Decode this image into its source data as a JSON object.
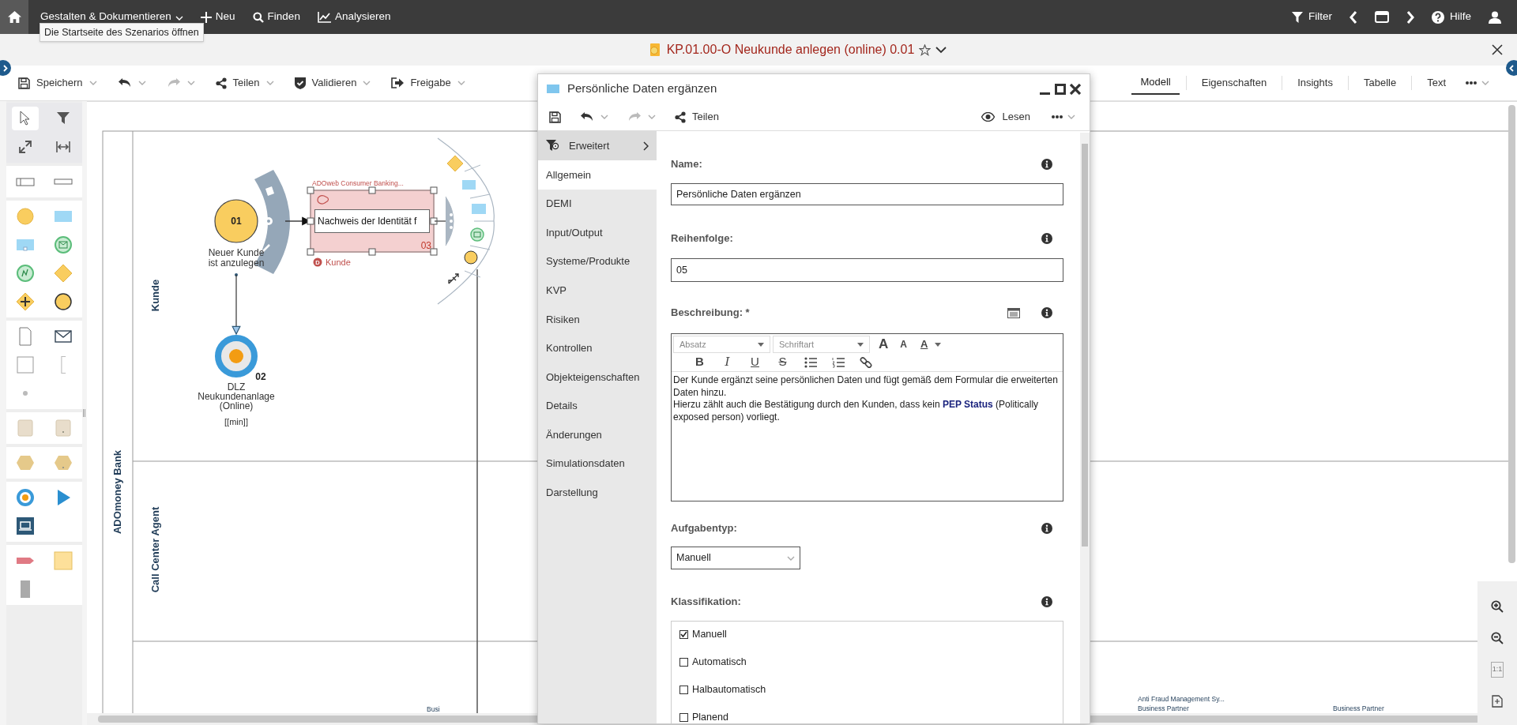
{
  "top_bar": {
    "home_tooltip": "Die Startseite des Szenarios öffnen",
    "menus": [
      {
        "kind": "dropdown",
        "label": "Gestalten & Dokumentieren"
      },
      {
        "kind": "new",
        "label": "Neu"
      },
      {
        "kind": "search",
        "label": "Finden"
      },
      {
        "kind": "chart",
        "label": "Analysieren"
      }
    ],
    "right": [
      {
        "kind": "filter",
        "label": "Filter"
      },
      {
        "kind": "prev"
      },
      {
        "kind": "window"
      },
      {
        "kind": "next"
      },
      {
        "kind": "help",
        "label": "Hilfe"
      },
      {
        "kind": "user"
      }
    ]
  },
  "model_title": {
    "title": "KP.01.00-O Neukunde anlegen (online) 0.01",
    "favorite": false
  },
  "toolbar": {
    "buttons": [
      {
        "kind": "save",
        "label": "Speichern"
      },
      {
        "kind": "undo",
        "disabled": false
      },
      {
        "kind": "redo",
        "disabled": true
      },
      {
        "kind": "share",
        "label": "Teilen"
      },
      {
        "kind": "validate",
        "label": "Validieren"
      },
      {
        "kind": "release",
        "label": "Freigabe"
      }
    ],
    "view_tabs": [
      {
        "label": "Modell",
        "selected": true
      },
      {
        "label": "Eigenschaften",
        "selected": false
      },
      {
        "label": "Insights",
        "selected": false
      },
      {
        "label": "Tabelle",
        "selected": false
      },
      {
        "label": "Text",
        "selected": false
      }
    ]
  },
  "diagram": {
    "pool": "ADOmoney Bank",
    "lanes": [
      {
        "label": "Kunde"
      },
      {
        "label": "Call Center Agent"
      }
    ],
    "start_event": {
      "number": "01",
      "label_lines": [
        "Neuer Kunde",
        "ist anzulegen"
      ]
    },
    "task": {
      "system": "ADOweb Consumer Banking...",
      "editing_text": "Nachweis der Identität f",
      "number": "03",
      "role_badge": "D",
      "role": "Kunde",
      "selected": true
    },
    "end_event": {
      "number": "02",
      "label_lines": [
        "DLZ",
        "Neukundenanlage",
        "(Online)"
      ],
      "unit": "[[min]]"
    },
    "bottom_labels": [
      "Busi",
      "Anti Fraud Management Sy...",
      "Business Partner",
      "Business Partner"
    ]
  },
  "zoom_controls": [
    {
      "kind": "zoom_in"
    },
    {
      "kind": "zoom_out"
    },
    {
      "kind": "actual_size",
      "label": "1:1",
      "disabled": true
    },
    {
      "kind": "fit"
    }
  ],
  "dialog": {
    "title": "Persönliche Daten ergänzen",
    "toolbar": {
      "buttons": [
        {
          "kind": "save"
        },
        {
          "kind": "undo",
          "disabled": false
        },
        {
          "kind": "redo",
          "disabled": true
        },
        {
          "kind": "share",
          "label": "Teilen"
        }
      ],
      "mode": "Lesen"
    },
    "filter": "Erweitert",
    "nav": [
      {
        "label": "Allgemein",
        "selected": true
      },
      {
        "label": "DEMI",
        "selected": false
      },
      {
        "label": "Input/Output",
        "selected": false
      },
      {
        "label": "Systeme/Produkte",
        "selected": false
      },
      {
        "label": "KVP",
        "selected": false
      },
      {
        "label": "Risiken",
        "selected": false
      },
      {
        "label": "Kontrollen",
        "selected": false
      },
      {
        "label": "Objekteigenschaften",
        "selected": false
      },
      {
        "label": "Details",
        "selected": false
      },
      {
        "label": "Änderungen",
        "selected": false
      },
      {
        "label": "Simulationsdaten",
        "selected": false
      },
      {
        "label": "Darstellung",
        "selected": false
      }
    ],
    "name": {
      "label": "Name:",
      "value": "Persönliche Daten ergänzen"
    },
    "order": {
      "label": "Reihenfolge:",
      "value": "05"
    },
    "description": {
      "label": "Beschreibung: *",
      "paragraph_style": "Absatz",
      "font": "Schriftart",
      "size_buttons": [
        {
          "kind": "grow",
          "label": "A"
        },
        {
          "kind": "shrink",
          "label": "A"
        },
        {
          "kind": "color",
          "label": "A"
        }
      ],
      "style_buttons": [
        {
          "kind": "bold",
          "label": "B"
        },
        {
          "kind": "italic",
          "label": "I"
        },
        {
          "kind": "underline",
          "label": "U"
        },
        {
          "kind": "strike",
          "label": "S"
        },
        {
          "kind": "bullets"
        },
        {
          "kind": "numbered"
        },
        {
          "kind": "link"
        }
      ],
      "paragraphs": [
        "Der Kunde ergänzt seine persönlichen Daten und fügt gemäß dem Formular die erweiterten Daten hinzu.",
        "Hierzu zählt auch die Bestätigung durch den Kunden, dass kein **PEP Status** (Politically exposed person) vorliegt."
      ]
    },
    "task_type": {
      "label": "Aufgabentyp:",
      "value": "Manuell"
    },
    "classification": {
      "label": "Klassifikation:",
      "options": [
        {
          "label": "Manuell",
          "checked": true
        },
        {
          "label": "Automatisch",
          "checked": false
        },
        {
          "label": "Halbautomatisch",
          "checked": false
        },
        {
          "label": "Planend",
          "checked": false
        }
      ]
    }
  }
}
